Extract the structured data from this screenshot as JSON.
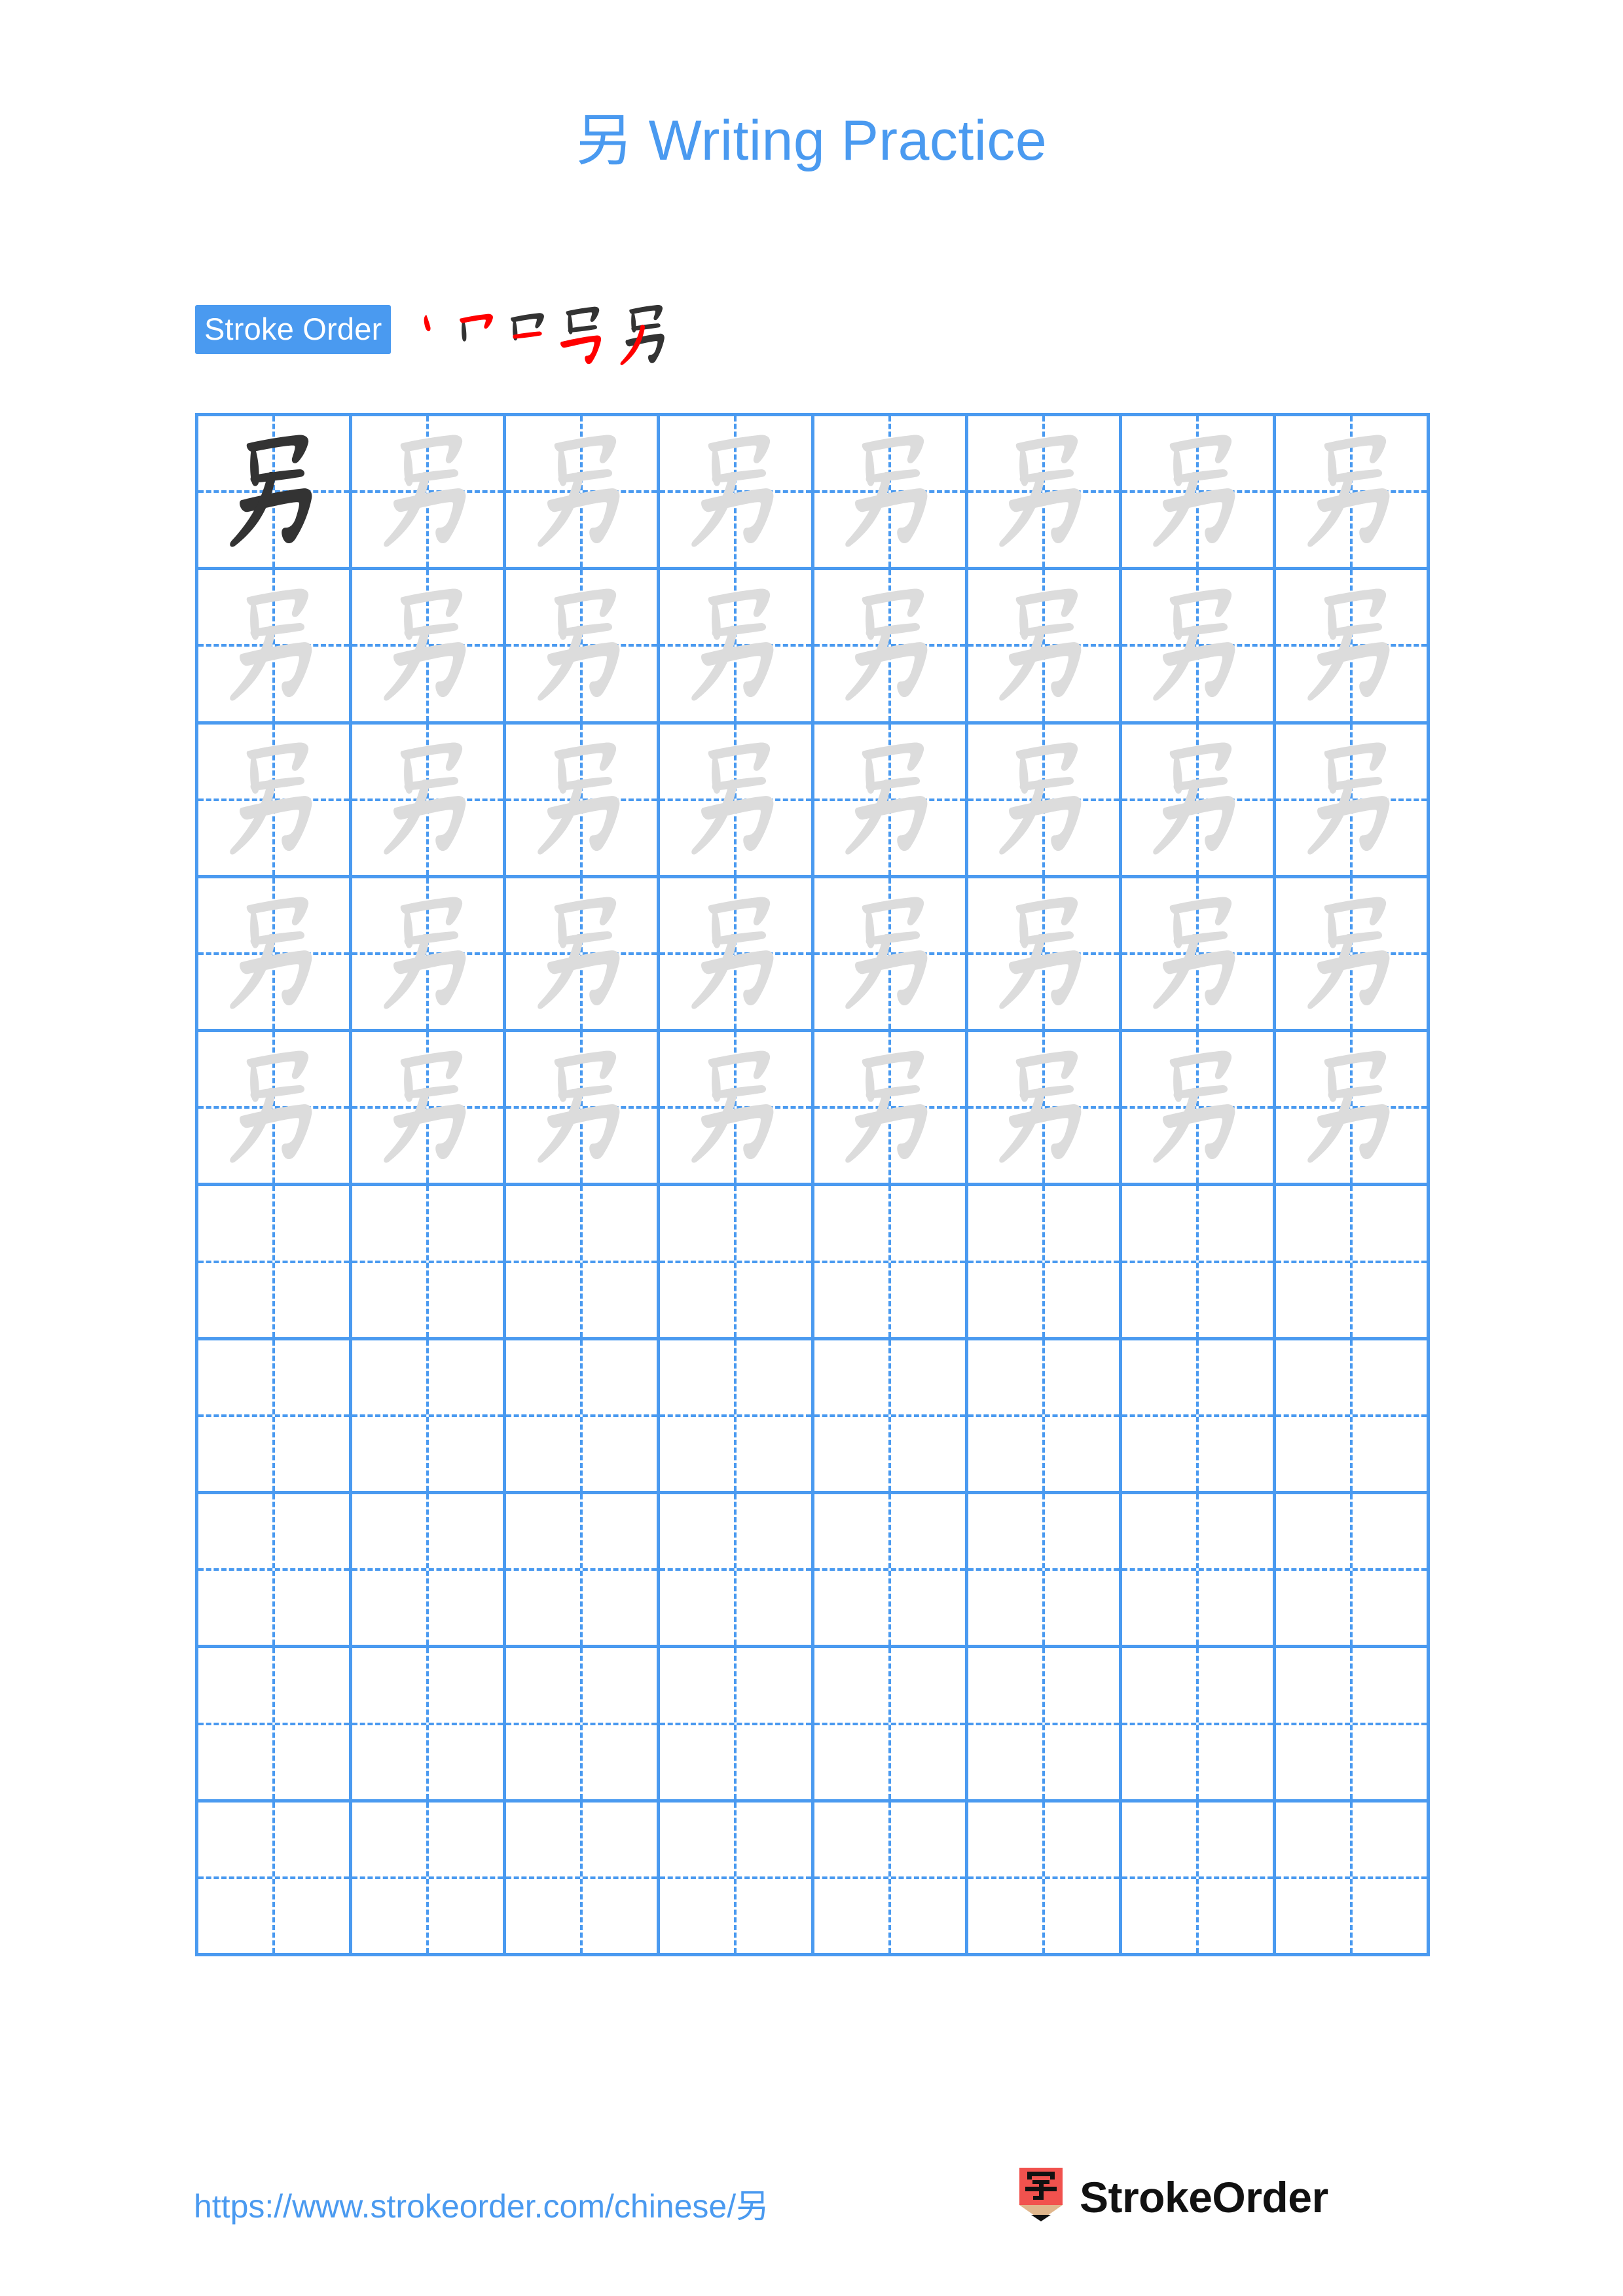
{
  "page": {
    "title_character": "另",
    "title_suffix": " Writing Practice",
    "background_color": "#ffffff",
    "accent_color": "#4a9af0"
  },
  "stroke_order": {
    "badge_label": "Stroke Order",
    "badge_bg_color": "#4a9af0",
    "badge_text_color": "#ffffff",
    "new_stroke_color": "#ff0000",
    "old_stroke_color": "#333333",
    "stroke_count": 5,
    "steps": [
      {
        "index": 1,
        "new_stroke_name": "dian-dot"
      },
      {
        "index": 2,
        "new_stroke_name": "hengzhe-horizontal-turn"
      },
      {
        "index": 3,
        "new_stroke_name": "heng-horizontal-close"
      },
      {
        "index": 4,
        "new_stroke_name": "hengzhezhewangou-hook"
      },
      {
        "index": 5,
        "new_stroke_name": "pie-left-falling"
      }
    ]
  },
  "practice_grid": {
    "columns": 8,
    "rows": 10,
    "filled_rows": 5,
    "model_cell": {
      "row": 1,
      "column": 1
    },
    "grid_line_color": "#4a9af0",
    "model_glyph_color": "#333333",
    "trace_glyph_color": "#dcdcdc",
    "character": "另"
  },
  "footer": {
    "url": "https://www.strokeorder.com/chinese/",
    "url_character": "另",
    "url_color": "#4a9af0",
    "brand_name": "StrokeOrder",
    "logo_character": "字",
    "logo_body_color": "#f1524e",
    "logo_tip_color": "#e0b68c",
    "logo_point_color": "#111111"
  }
}
